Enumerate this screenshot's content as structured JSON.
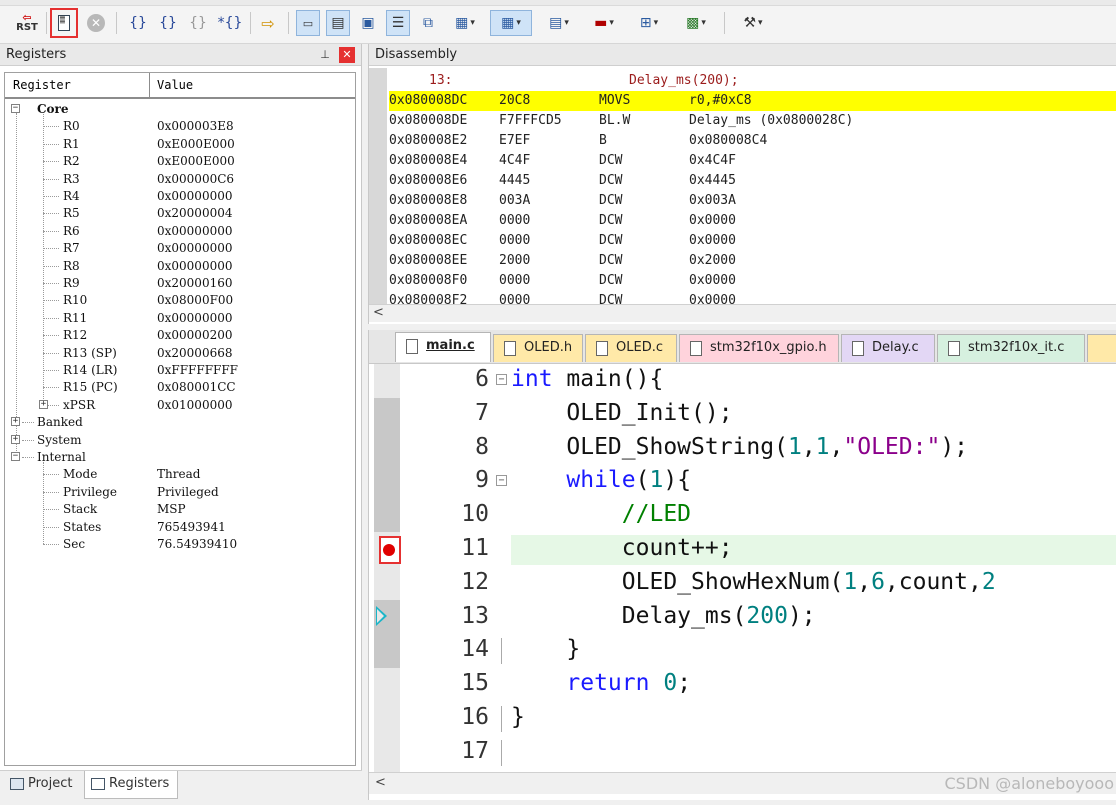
{
  "toolbar": {
    "buttons": [
      {
        "name": "reset-button",
        "label": "RST"
      },
      {
        "name": "command-window-button",
        "icon": "command-window-icon"
      },
      {
        "name": "stop-button",
        "icon": "stop-icon"
      },
      {
        "name": "step-button",
        "label": "{}"
      },
      {
        "name": "step-over-button",
        "label": "{}"
      },
      {
        "name": "step-out-button",
        "label": "{}"
      },
      {
        "name": "run-to-cursor-button",
        "label": "*{}"
      },
      {
        "name": "show-next-statement-button",
        "icon": "arrow-right-icon"
      }
    ],
    "highlight_color": "#e53030"
  },
  "registers_panel": {
    "title": "Registers",
    "col_register": "Register",
    "col_value": "Value",
    "core_label": "Core",
    "core": [
      {
        "name": "R0",
        "value": "0x000003E8"
      },
      {
        "name": "R1",
        "value": "0xE000E000"
      },
      {
        "name": "R2",
        "value": "0xE000E000"
      },
      {
        "name": "R3",
        "value": "0x000000C6"
      },
      {
        "name": "R4",
        "value": "0x00000000"
      },
      {
        "name": "R5",
        "value": "0x20000004"
      },
      {
        "name": "R6",
        "value": "0x00000000"
      },
      {
        "name": "R7",
        "value": "0x00000000"
      },
      {
        "name": "R8",
        "value": "0x00000000"
      },
      {
        "name": "R9",
        "value": "0x20000160"
      },
      {
        "name": "R10",
        "value": "0x08000F00"
      },
      {
        "name": "R11",
        "value": "0x00000000"
      },
      {
        "name": "R12",
        "value": "0x00000200"
      },
      {
        "name": "R13 (SP)",
        "value": "0x20000668"
      },
      {
        "name": "R14 (LR)",
        "value": "0xFFFFFFFF"
      },
      {
        "name": "R15 (PC)",
        "value": "0x080001CC"
      },
      {
        "name": "xPSR",
        "value": "0x01000000"
      }
    ],
    "groups": [
      "Banked",
      "System",
      "Internal"
    ],
    "internal": [
      {
        "name": "Mode",
        "value": "Thread"
      },
      {
        "name": "Privilege",
        "value": "Privileged"
      },
      {
        "name": "Stack",
        "value": "MSP"
      },
      {
        "name": "States",
        "value": "765493941"
      },
      {
        "name": "Sec",
        "value": "76.54939410"
      }
    ]
  },
  "bottom_tabs": {
    "project": "Project",
    "registers": "Registers"
  },
  "disassembly": {
    "title": "Disassembly",
    "source_line": {
      "num": "13:",
      "text": "Delay_ms(200);"
    },
    "rows": [
      {
        "addr": "0x080008DC",
        "code": "20C8",
        "mnem": "MOVS",
        "ops": "r0,#0xC8",
        "current": true
      },
      {
        "addr": "0x080008DE",
        "code": "F7FFFCD5",
        "mnem": "BL.W",
        "ops": "Delay_ms (0x0800028C)"
      },
      {
        "addr": "0x080008E2",
        "code": "E7EF",
        "mnem": "B",
        "ops": "0x080008C4"
      },
      {
        "addr": "0x080008E4",
        "code": "4C4F",
        "mnem": "DCW",
        "ops": "0x4C4F"
      },
      {
        "addr": "0x080008E6",
        "code": "4445",
        "mnem": "DCW",
        "ops": "0x4445"
      },
      {
        "addr": "0x080008E8",
        "code": "003A",
        "mnem": "DCW",
        "ops": "0x003A"
      },
      {
        "addr": "0x080008EA",
        "code": "0000",
        "mnem": "DCW",
        "ops": "0x0000"
      },
      {
        "addr": "0x080008EC",
        "code": "0000",
        "mnem": "DCW",
        "ops": "0x0000"
      },
      {
        "addr": "0x080008EE",
        "code": "2000",
        "mnem": "DCW",
        "ops": "0x2000"
      },
      {
        "addr": "0x080008F0",
        "code": "0000",
        "mnem": "DCW",
        "ops": "0x0000"
      },
      {
        "addr": "0x080008F2",
        "code": "0000",
        "mnem": "DCW",
        "ops": "0x0000"
      }
    ],
    "current_color": "#ffff00"
  },
  "editor": {
    "tabs": [
      {
        "label": "main.c",
        "color": "#ffffff",
        "active": true
      },
      {
        "label": "OLED.h",
        "color": "#ffe9a8"
      },
      {
        "label": "OLED.c",
        "color": "#ffe9a8"
      },
      {
        "label": "stm32f10x_gpio.h",
        "color": "#ffd3dc"
      },
      {
        "label": "Delay.c",
        "color": "#e3d7f5"
      },
      {
        "label": "stm32f10x_it.c",
        "color": "#d6f0df"
      }
    ],
    "lines": [
      {
        "num": "6",
        "tokens": [
          {
            "t": "int",
            "c": "kw"
          },
          {
            "t": " main(){"
          }
        ]
      },
      {
        "num": "7",
        "tokens": [
          {
            "t": "    OLED_Init();"
          }
        ]
      },
      {
        "num": "8",
        "tokens": [
          {
            "t": "    OLED_ShowString("
          },
          {
            "t": "1",
            "c": "num"
          },
          {
            "t": ","
          },
          {
            "t": "1",
            "c": "num"
          },
          {
            "t": ","
          },
          {
            "t": "\"OLED:\"",
            "c": "str"
          },
          {
            "t": ");"
          }
        ]
      },
      {
        "num": "9",
        "tokens": [
          {
            "t": "    "
          },
          {
            "t": "while",
            "c": "kw"
          },
          {
            "t": "("
          },
          {
            "t": "1",
            "c": "num"
          },
          {
            "t": "){"
          }
        ]
      },
      {
        "num": "10",
        "tokens": [
          {
            "t": "        "
          },
          {
            "t": "//LED",
            "c": "cmt"
          }
        ]
      },
      {
        "num": "11",
        "tokens": [
          {
            "t": "        count++;"
          }
        ],
        "highlight": true,
        "breakpoint": true
      },
      {
        "num": "12",
        "tokens": [
          {
            "t": "        OLED_ShowHexNum("
          },
          {
            "t": "1",
            "c": "num"
          },
          {
            "t": ","
          },
          {
            "t": "6",
            "c": "num"
          },
          {
            "t": ",count,"
          },
          {
            "t": "2",
            "c": "num"
          }
        ]
      },
      {
        "num": "13",
        "tokens": [
          {
            "t": "        Delay_ms("
          },
          {
            "t": "200",
            "c": "num"
          },
          {
            "t": ");"
          }
        ],
        "current": true
      },
      {
        "num": "14",
        "tokens": [
          {
            "t": "    }"
          }
        ]
      },
      {
        "num": "15",
        "tokens": [
          {
            "t": "    "
          },
          {
            "t": "return",
            "c": "kw"
          },
          {
            "t": " "
          },
          {
            "t": "0",
            "c": "num"
          },
          {
            "t": ";"
          }
        ]
      },
      {
        "num": "16",
        "tokens": [
          {
            "t": "}"
          }
        ]
      },
      {
        "num": "17",
        "tokens": []
      }
    ],
    "breakpoint_color": "#e00000",
    "watermark": "CSDN @aloneboyooo"
  }
}
